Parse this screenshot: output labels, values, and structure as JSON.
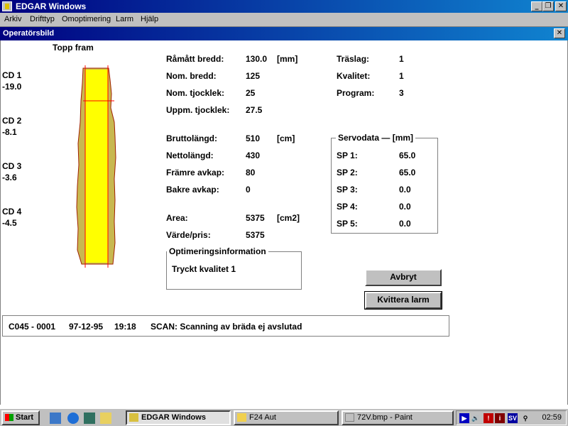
{
  "window": {
    "title": "EDGAR Windows"
  },
  "menu": [
    "Arkiv",
    "Drifttyp",
    "Omoptimering",
    "Larm",
    "Hjälp"
  ],
  "child": {
    "title": "Operatörsbild"
  },
  "board": {
    "caption": "Topp fram",
    "cds": [
      {
        "label": "CD 1",
        "value": "-19.0"
      },
      {
        "label": "CD 2",
        "value": "-8.1"
      },
      {
        "label": "CD 3",
        "value": "-3.6"
      },
      {
        "label": "CD 4",
        "value": "-4.5"
      }
    ],
    "colors": {
      "wane": "#c8b850",
      "wood": "#ffff00",
      "line": "#ff0000",
      "outline": "#a02000"
    }
  },
  "dims": {
    "rows": [
      {
        "label": "Råmått bredd:",
        "value": "130.0",
        "unit": "[mm]"
      },
      {
        "label": "Nom. bredd:",
        "value": "125",
        "unit": ""
      },
      {
        "label": "Nom. tjocklek:",
        "value": "25",
        "unit": ""
      },
      {
        "label": "Uppm. tjocklek:",
        "value": "27.5",
        "unit": ""
      }
    ]
  },
  "lengths": {
    "rows": [
      {
        "label": "Bruttolängd:",
        "value": "510",
        "unit": "[cm]"
      },
      {
        "label": "Nettolängd:",
        "value": "430",
        "unit": ""
      },
      {
        "label": "Främre avkap:",
        "value": "80",
        "unit": ""
      },
      {
        "label": "Bakre avkap:",
        "value": "0",
        "unit": ""
      }
    ]
  },
  "area": {
    "rows": [
      {
        "label": "Area:",
        "value": "5375",
        "unit": "[cm2]"
      },
      {
        "label": "Värde/pris:",
        "value": "5375",
        "unit": ""
      }
    ]
  },
  "wood": {
    "rows": [
      {
        "label": "Träslag:",
        "value": "1"
      },
      {
        "label": "Kvalitet:",
        "value": "1"
      },
      {
        "label": "Program:",
        "value": "3"
      }
    ]
  },
  "servo": {
    "legend": "Servodata — [mm]",
    "rows": [
      {
        "label": "SP 1:",
        "value": "65.0"
      },
      {
        "label": "SP 2:",
        "value": "65.0"
      },
      {
        "label": "SP 3:",
        "value": "0.0"
      },
      {
        "label": "SP 4:",
        "value": "0.0"
      },
      {
        "label": "SP 5:",
        "value": "0.0"
      }
    ]
  },
  "opt": {
    "legend": "Optimeringsinformation",
    "text": "Tryckt kvalitet 1"
  },
  "buttons": {
    "cancel": "Avbryt",
    "ack": "Kvittera larm"
  },
  "status": {
    "code": "C045 - 0001",
    "date": "97-12-95",
    "time": "19:18",
    "message": "SCAN: Scanning av bräda ej avslutad"
  },
  "taskbar": {
    "start": "Start",
    "tasks": [
      "EDGAR Windows",
      "F24 Aut",
      "72V.bmp - Paint"
    ],
    "tray": {
      "lang": "SV",
      "clock": "02:59"
    }
  }
}
